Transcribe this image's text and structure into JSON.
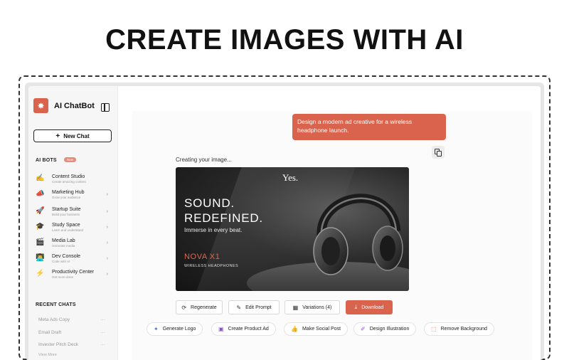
{
  "headline": "CREATE IMAGES WITH AI",
  "app": {
    "name": "AI ChatBot",
    "new_chat": "New Chat"
  },
  "ai_bots": {
    "title": "AI BOTS",
    "badge": "New",
    "items": [
      {
        "title": "Content Studio",
        "subtitle": "Create amazing content",
        "icon": "pencil-icon",
        "glyph": "✍"
      },
      {
        "title": "Marketing Hub",
        "subtitle": "Grow your audience",
        "icon": "megaphone-icon",
        "glyph": "📣"
      },
      {
        "title": "Startup Suite",
        "subtitle": "Build your business",
        "icon": "rocket-icon",
        "glyph": "🚀"
      },
      {
        "title": "Study Space",
        "subtitle": "Learn and understand",
        "icon": "graduation-cap-icon",
        "glyph": "🎓"
      },
      {
        "title": "Media Lab",
        "subtitle": "Generate media",
        "icon": "clapperboard-icon",
        "glyph": "🎬"
      },
      {
        "title": "Dev Console",
        "subtitle": "Code with AI",
        "icon": "developer-icon",
        "glyph": "👨‍💻"
      },
      {
        "title": "Productivity Center",
        "subtitle": "Get more done",
        "icon": "lightning-icon",
        "glyph": "⚡"
      }
    ]
  },
  "recent_chats": {
    "title": "RECENT CHATS",
    "items": [
      "Meta Ads Copy",
      "Email Draft",
      "Invester Pitch Deck"
    ],
    "more_glyph": "···",
    "view_more": "View More"
  },
  "chat": {
    "user_message": "Design a modern ad creative for a wireless headphone launch.",
    "status": "Creating your image..."
  },
  "ad_image": {
    "tagline_top": "Yes.",
    "headline_line1": "SOUND.",
    "headline_line2": "REDEFINED.",
    "subline": "Immerse in every beat.",
    "model": "NOVA X1",
    "product": "WIRELESS HEADPHONES"
  },
  "actions": {
    "regenerate": "Regenerate",
    "edit_prompt": "Edit Prompt",
    "variations": "Variations (4)",
    "download": "Download"
  },
  "suggestions": {
    "generate_logo": "Generate Logo",
    "create_product_ad": "Create Product Ad",
    "make_social_post": "Make Social Post",
    "design_illustration": "Design Illustration",
    "remove_background": "Remove Background"
  },
  "colors": {
    "accent": "#d9634c",
    "sidebar_bg": "#f6f6f6"
  }
}
